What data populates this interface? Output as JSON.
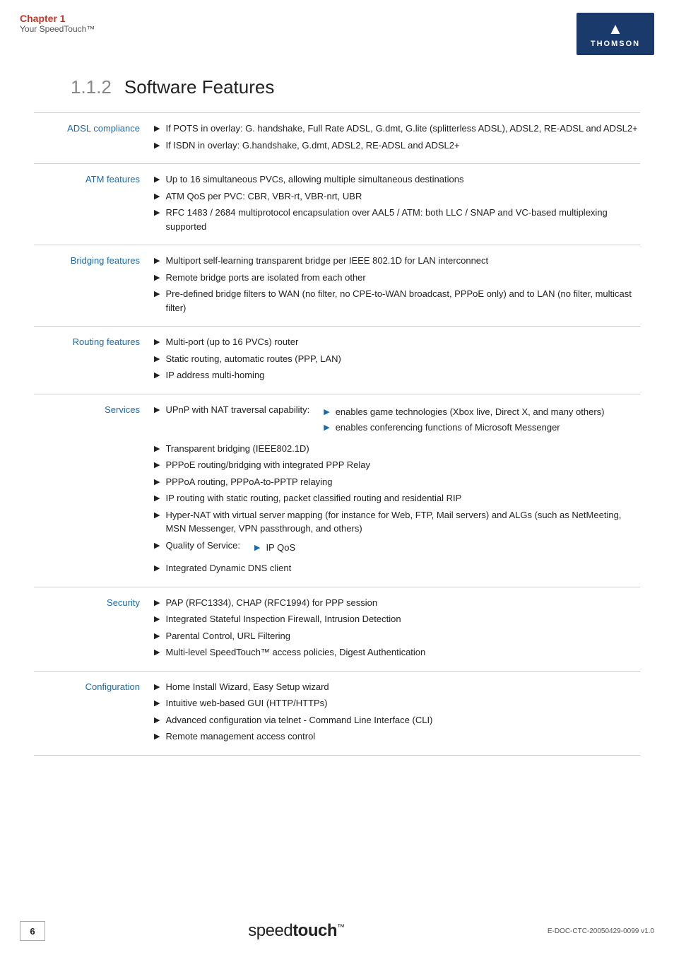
{
  "header": {
    "chapter_label": "Chapter 1",
    "chapter_sub": "Your SpeedTouch™",
    "logo_icon": "▲",
    "logo_text": "THOMSON"
  },
  "section": {
    "number": "1.1.2",
    "title": "Software Features"
  },
  "features": [
    {
      "label": "ADSL compliance",
      "items": [
        {
          "text": "If POTS in overlay: G. handshake, Full Rate ADSL, G.dmt, G.lite (splitterless ADSL), ADSL2, RE-ADSL and ADSL2+",
          "sub": []
        },
        {
          "text": "If ISDN in overlay: G.handshake, G.dmt, ADSL2, RE-ADSL and ADSL2+",
          "sub": []
        }
      ]
    },
    {
      "label": "ATM features",
      "items": [
        {
          "text": "Up to 16 simultaneous PVCs, allowing multiple simultaneous destinations",
          "sub": []
        },
        {
          "text": "ATM QoS per PVC: CBR, VBR-rt, VBR-nrt, UBR",
          "sub": []
        },
        {
          "text": "RFC 1483 / 2684 multiprotocol encapsulation over AAL5 / ATM: both LLC / SNAP and VC-based multiplexing supported",
          "sub": []
        }
      ]
    },
    {
      "label": "Bridging features",
      "items": [
        {
          "text": "Multiport self-learning transparent bridge per IEEE 802.1D for LAN interconnect",
          "sub": []
        },
        {
          "text": "Remote bridge ports are isolated from each other",
          "sub": []
        },
        {
          "text": "Pre-defined bridge filters to WAN (no filter, no CPE-to-WAN broadcast, PPPoE only) and to LAN (no filter, multicast filter)",
          "sub": []
        }
      ]
    },
    {
      "label": "Routing features",
      "items": [
        {
          "text": "Multi-port (up to 16 PVCs) router",
          "sub": []
        },
        {
          "text": "Static routing, automatic routes (PPP, LAN)",
          "sub": []
        },
        {
          "text": "IP address multi-homing",
          "sub": []
        }
      ]
    },
    {
      "label": "Services",
      "items": [
        {
          "text": "UPnP with NAT traversal capability:",
          "sub": [
            "enables game technologies (Xbox live, Direct X, and many others)",
            "enables conferencing functions of Microsoft Messenger"
          ]
        },
        {
          "text": "Transparent bridging (IEEE802.1D)",
          "sub": []
        },
        {
          "text": "PPPoE routing/bridging with integrated PPP Relay",
          "sub": []
        },
        {
          "text": "PPPoA routing, PPPoA-to-PPTP relaying",
          "sub": []
        },
        {
          "text": "IP routing with static routing, packet classified routing and residential RIP",
          "sub": []
        },
        {
          "text": "Hyper-NAT with virtual server mapping (for instance for Web, FTP, Mail servers) and ALGs (such as NetMeeting, MSN Messenger, VPN passthrough, and others)",
          "sub": []
        },
        {
          "text": "Quality of Service:",
          "sub": [
            "IP QoS"
          ]
        },
        {
          "text": "Integrated Dynamic DNS client",
          "sub": []
        }
      ]
    },
    {
      "label": "Security",
      "items": [
        {
          "text": "PAP (RFC1334), CHAP (RFC1994) for PPP session",
          "sub": []
        },
        {
          "text": "Integrated Stateful Inspection Firewall, Intrusion Detection",
          "sub": []
        },
        {
          "text": "Parental Control, URL Filtering",
          "sub": []
        },
        {
          "text": "Multi-level SpeedTouch™ access policies, Digest Authentication",
          "sub": []
        }
      ]
    },
    {
      "label": "Configuration",
      "items": [
        {
          "text": "Home Install Wizard, Easy Setup wizard",
          "sub": []
        },
        {
          "text": "Intuitive web-based GUI (HTTP/HTTPs)",
          "sub": []
        },
        {
          "text": "Advanced configuration via telnet - Command Line Interface (CLI)",
          "sub": []
        },
        {
          "text": "Remote management access control",
          "sub": []
        }
      ]
    }
  ],
  "footer": {
    "page_number": "6",
    "brand_text": "speed",
    "brand_bold": "touch",
    "brand_tm": "™",
    "doc_ref": "E-DOC-CTC-20050429-0099 v1.0"
  }
}
